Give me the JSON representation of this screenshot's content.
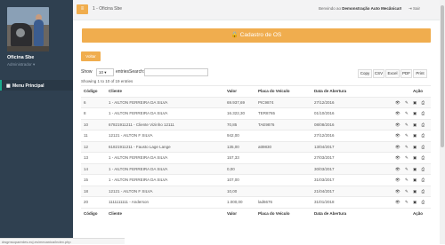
{
  "sidebar": {
    "user_name": "Oficina Sbe",
    "user_role": "Administrador ▾",
    "menu_label": "Menu Principal"
  },
  "topbar": {
    "menu_icon": "≡",
    "brand": "1 - Oficina Sbe",
    "welcome_prefix": "Benvindo ao ",
    "welcome_name": "Demonstração Auto Mecânica!!",
    "logout": "Sair"
  },
  "panel": {
    "title": "Cadastro de OS",
    "back_button": "Voltar"
  },
  "controls": {
    "show_label": "Show",
    "page_length": "10",
    "entries_label": "entriesSearch:",
    "info": "Showing 1 to 10 of 19 entries",
    "export_buttons": [
      "Copy",
      "CSV",
      "Excel",
      "PDF",
      "Print"
    ]
  },
  "table": {
    "headers": [
      "Código",
      "Cliente",
      "Valor",
      "Placa do Veículo",
      "Data de Abertura",
      "Ação"
    ],
    "rows": [
      [
        "6",
        "1 - AILTON FERREIRA DA SILVA",
        "69.937,69",
        "PIC9874",
        "27/12/2016"
      ],
      [
        "8",
        "1 - AILTON FERREIRA DA SILVA",
        "16.322,30",
        "TER8765",
        "01/10/2016"
      ],
      [
        "10",
        "67821911211 - Cliente Vizinho 12111",
        "70,85",
        "TAE9876",
        "08/08/2016"
      ],
      [
        "11",
        "12121 - AILTON F SILVA",
        "942,00",
        "",
        "27/12/2016"
      ],
      [
        "12",
        "61821911211 - Fausto Lage Lange",
        "135,00",
        "att9830",
        "13/04/2017"
      ],
      [
        "13",
        "1 - AILTON FERREIRA DA SILVA",
        "157,33",
        "",
        "27/03/2017"
      ],
      [
        "14",
        "1 - AILTON FERREIRA DA SILVA",
        "0,00",
        "",
        "30/03/2017"
      ],
      [
        "15",
        "1 - AILTON FERREIRA DA SILVA",
        "107,00",
        "",
        "31/03/2017"
      ],
      [
        "18",
        "12121 - AILTON F SILVA",
        "10,00",
        "",
        "21/04/2017"
      ],
      [
        "20",
        "1111111111 - Anderson",
        "1.000,00",
        "lad6676",
        "31/01/2018"
      ]
    ],
    "action_icons": "👁 ✎ ▣ ⎙"
  },
  "status_bar": "dwgmsopaerdes.ecj.es/mecanica/index.php"
}
